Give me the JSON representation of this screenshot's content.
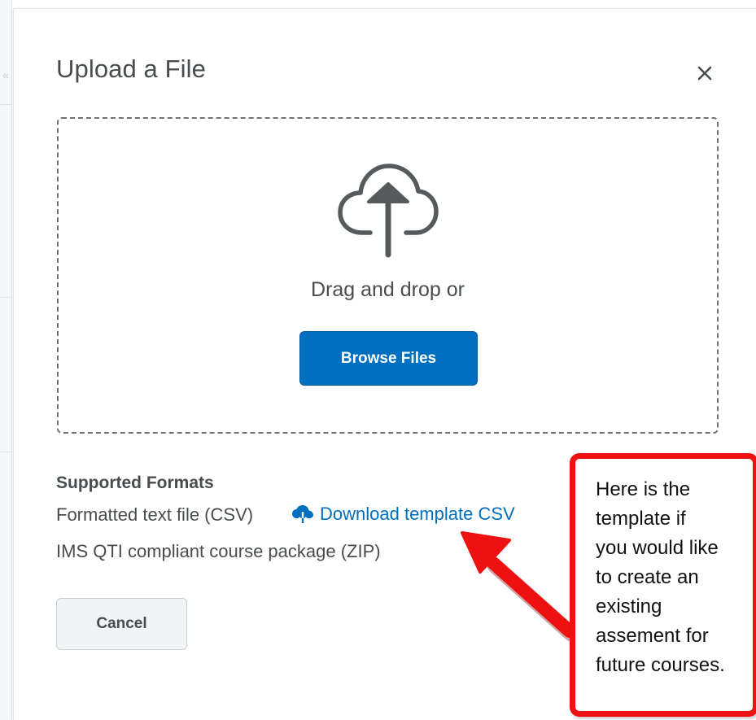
{
  "dialog": {
    "title": "Upload a File",
    "close_icon": "close-icon"
  },
  "dropzone": {
    "icon": "cloud-upload-icon",
    "prompt": "Drag and drop or",
    "browse_label": "Browse Files"
  },
  "formats": {
    "heading": "Supported Formats",
    "items": [
      {
        "label": "Formatted text file (CSV)",
        "link_label": "Download template CSV",
        "link_icon": "cloud-download-icon"
      },
      {
        "label": "IMS QTI compliant course package (ZIP)"
      }
    ]
  },
  "actions": {
    "cancel_label": "Cancel"
  },
  "annotation": {
    "text": "Here is the template if you would like to create an existing assement for future courses.",
    "lines": [
      "Here is the",
      "template if",
      "you would like",
      "to create an",
      "existing",
      "assement for",
      "future courses."
    ],
    "border_color": "#ee1111"
  },
  "colors": {
    "primary": "#006fbf",
    "text": "#494c4e",
    "dropzone_border": "#6e7376",
    "cancel_bg": "#f1f3f5"
  }
}
